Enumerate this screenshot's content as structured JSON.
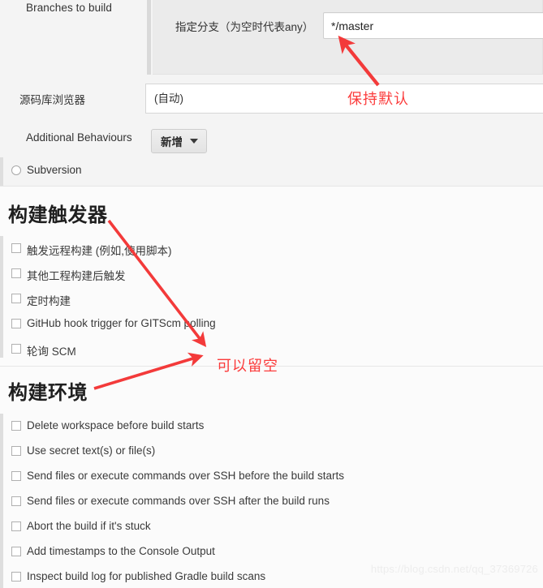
{
  "scm": {
    "branches_label": "Branches to build",
    "branch_spec_label": "指定分支（为空时代表any）",
    "branch_value": "*/master",
    "repo_browser_label": "源码库浏览器",
    "repo_browser_value": "(自动)",
    "additional_behaviours_label": "Additional Behaviours",
    "add_button_label": "新增",
    "subversion_label": "Subversion"
  },
  "triggers": {
    "title": "构建触发器",
    "items": [
      {
        "label": "触发远程构建 (例如,使用脚本)",
        "checked": false
      },
      {
        "label": "其他工程构建后触发",
        "checked": false
      },
      {
        "label": "定时构建",
        "checked": false
      },
      {
        "label": "GitHub hook trigger for GITScm polling",
        "checked": false
      },
      {
        "label": "轮询 SCM",
        "checked": false
      }
    ]
  },
  "environment": {
    "title": "构建环境",
    "items": [
      {
        "label": "Delete workspace before build starts",
        "checked": false
      },
      {
        "label": "Use secret text(s) or file(s)",
        "checked": false
      },
      {
        "label": "Send files or execute commands over SSH before the build starts",
        "checked": false
      },
      {
        "label": "Send files or execute commands over SSH after the build runs",
        "checked": false
      },
      {
        "label": "Abort the build if it's stuck",
        "checked": false
      },
      {
        "label": "Add timestamps to the Console Output",
        "checked": false
      },
      {
        "label": "Inspect build log for published Gradle build scans",
        "checked": false
      }
    ]
  },
  "annotations": {
    "color": "#fb3b3b",
    "notes": [
      {
        "text": "保持默认"
      },
      {
        "text": "可以留空"
      }
    ]
  },
  "watermark": {
    "text": "https://blog.csdn.net/qq_37369726"
  }
}
